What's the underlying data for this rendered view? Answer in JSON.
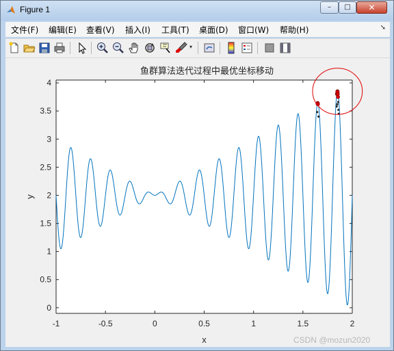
{
  "window": {
    "title": "Figure 1",
    "controls": {
      "minimize": "–",
      "maximize": "□",
      "close": "✕"
    }
  },
  "menu": [
    {
      "label": "文件(F)",
      "name": "menu-file"
    },
    {
      "label": "编辑(E)",
      "name": "menu-edit"
    },
    {
      "label": "查看(V)",
      "name": "menu-view"
    },
    {
      "label": "插入(I)",
      "name": "menu-insert"
    },
    {
      "label": "工具(T)",
      "name": "menu-tools"
    },
    {
      "label": "桌面(D)",
      "name": "menu-desktop"
    },
    {
      "label": "窗口(W)",
      "name": "menu-window"
    },
    {
      "label": "帮助(H)",
      "name": "menu-help"
    }
  ],
  "toolbar": [
    {
      "icon": "new-figure-icon"
    },
    {
      "icon": "open-file-icon"
    },
    {
      "icon": "save-icon"
    },
    {
      "icon": "print-icon"
    },
    {
      "icon": "edit-plot-arrow-icon"
    },
    {
      "icon": "zoom-in-icon"
    },
    {
      "icon": "zoom-out-icon"
    },
    {
      "icon": "pan-hand-icon"
    },
    {
      "icon": "rotate-3d-icon"
    },
    {
      "icon": "data-cursor-icon"
    },
    {
      "icon": "brush-icon"
    },
    {
      "icon": "link-plot-icon"
    },
    {
      "icon": "colorbar-icon"
    },
    {
      "icon": "legend-icon"
    },
    {
      "icon": "hide-plot-tools-icon"
    },
    {
      "icon": "show-plot-tools-icon"
    }
  ],
  "chart_data": {
    "type": "line",
    "title": "鱼群算法迭代过程中最优坐标移动",
    "xlabel": "x",
    "ylabel": "y",
    "function": "y = x*sin(10*pi*x) + 2",
    "x_range": [
      -1,
      2
    ],
    "xlim": [
      -1,
      2
    ],
    "ylim": [
      -0.1,
      4.05
    ],
    "x_ticks": [
      "-1",
      "-0.5",
      "0",
      "0.5",
      "1",
      "1.5",
      "2"
    ],
    "y_ticks": [
      "0",
      "0.5",
      "1",
      "1.5",
      "2",
      "2.5",
      "3",
      "3.5",
      "4"
    ],
    "line_color": "#0072bd",
    "marker_color": "#d40000",
    "point_color": "#2a2a2a",
    "best_points": [
      {
        "x": 1.648,
        "y": 3.63
      },
      {
        "x": 1.649,
        "y": 3.64
      },
      {
        "x": 1.65,
        "y": 3.64
      },
      {
        "x": 1.652,
        "y": 3.62
      },
      {
        "x": 1.846,
        "y": 3.8
      },
      {
        "x": 1.848,
        "y": 3.82
      },
      {
        "x": 1.85,
        "y": 3.85
      },
      {
        "x": 1.851,
        "y": 3.84
      },
      {
        "x": 1.853,
        "y": 3.8
      },
      {
        "x": 1.855,
        "y": 3.75
      }
    ],
    "scatter_points": [
      {
        "x": 1.645,
        "y": 3.48
      },
      {
        "x": 1.658,
        "y": 3.4
      },
      {
        "x": 1.842,
        "y": 3.58
      },
      {
        "x": 1.848,
        "y": 3.62
      },
      {
        "x": 1.86,
        "y": 3.52
      },
      {
        "x": 1.862,
        "y": 3.45
      },
      {
        "x": 1.858,
        "y": 3.66
      }
    ],
    "highlight_circle": {
      "cx": 1.85,
      "cy": 3.85,
      "r_x": 0.45,
      "color": "#e00000"
    },
    "grid": false
  },
  "watermark": "CSDN @mozun2020"
}
